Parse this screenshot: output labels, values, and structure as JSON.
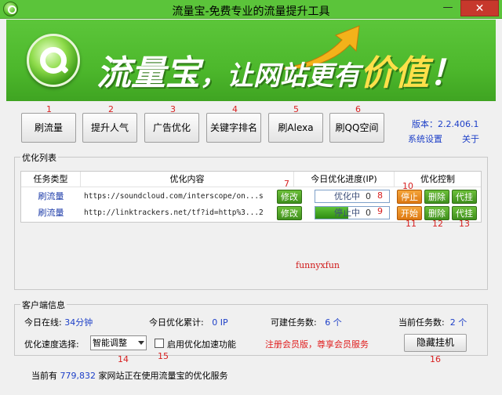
{
  "window": {
    "title": "流量宝-免费专业的流量提升工具",
    "minimize_label": "—",
    "close_label": "✕"
  },
  "banner": {
    "part1": "流量宝",
    "comma": "，",
    "part2": "让网站更有",
    "part3": "价值",
    "part4": "！"
  },
  "toolbar": {
    "buttons": [
      {
        "label": "刷流量",
        "num": "1"
      },
      {
        "label": "提升人气",
        "num": "2"
      },
      {
        "label": "广告优化",
        "num": "3"
      },
      {
        "label": "关键字排名",
        "num": "4"
      },
      {
        "label": "刷Alexa",
        "num": "5"
      },
      {
        "label": "刷QQ空间",
        "num": "6"
      }
    ],
    "version": "版本：2.2.406.1",
    "settings_link": "系统设置",
    "about_link": "关于"
  },
  "list": {
    "group_title": "优化列表",
    "headers": [
      "任务类型",
      "优化内容",
      "今日优化进度(IP)",
      "优化控制"
    ],
    "rows": [
      {
        "type": "刷流量",
        "url": "https://soundcloud.com/interscope/on...s",
        "edit": "修改",
        "status": "优化中",
        "count": "0",
        "progress": 0,
        "btn1": "停止",
        "btn2": "删除",
        "btn3": "代挂"
      },
      {
        "type": "刷流量",
        "url": "http://linktrackers.net/tf?id=http%3...2",
        "edit": "修改",
        "status": "停止中",
        "count": "0",
        "progress": 0.45,
        "btn1": "开始",
        "btn2": "删除",
        "btn3": "代挂"
      }
    ],
    "annotations": [
      "7",
      "8",
      "9",
      "10",
      "11",
      "12",
      "13"
    ],
    "watermark": "funnyxfun"
  },
  "client": {
    "group_title": "客户端信息",
    "online_label": "今日在线:",
    "online_value": "34分钟",
    "total_label": "今日优化累计:",
    "total_value": "0 IP",
    "can_build_label": "可建任务数:",
    "can_build_value": "6 个",
    "current_label": "当前任务数:",
    "current_value": "2 个",
    "speed_label": "优化速度选择:",
    "speed_value": "智能调整",
    "accel_label": "启用优化加速功能",
    "member_link": "注册会员版，尊享会员服务",
    "hide_button": "隐藏挂机",
    "annotations": [
      "14",
      "15",
      "16"
    ]
  },
  "footer": {
    "prefix": "当前有",
    "count": "779,832",
    "suffix": "家网站正在使用流量宝的优化服务"
  }
}
